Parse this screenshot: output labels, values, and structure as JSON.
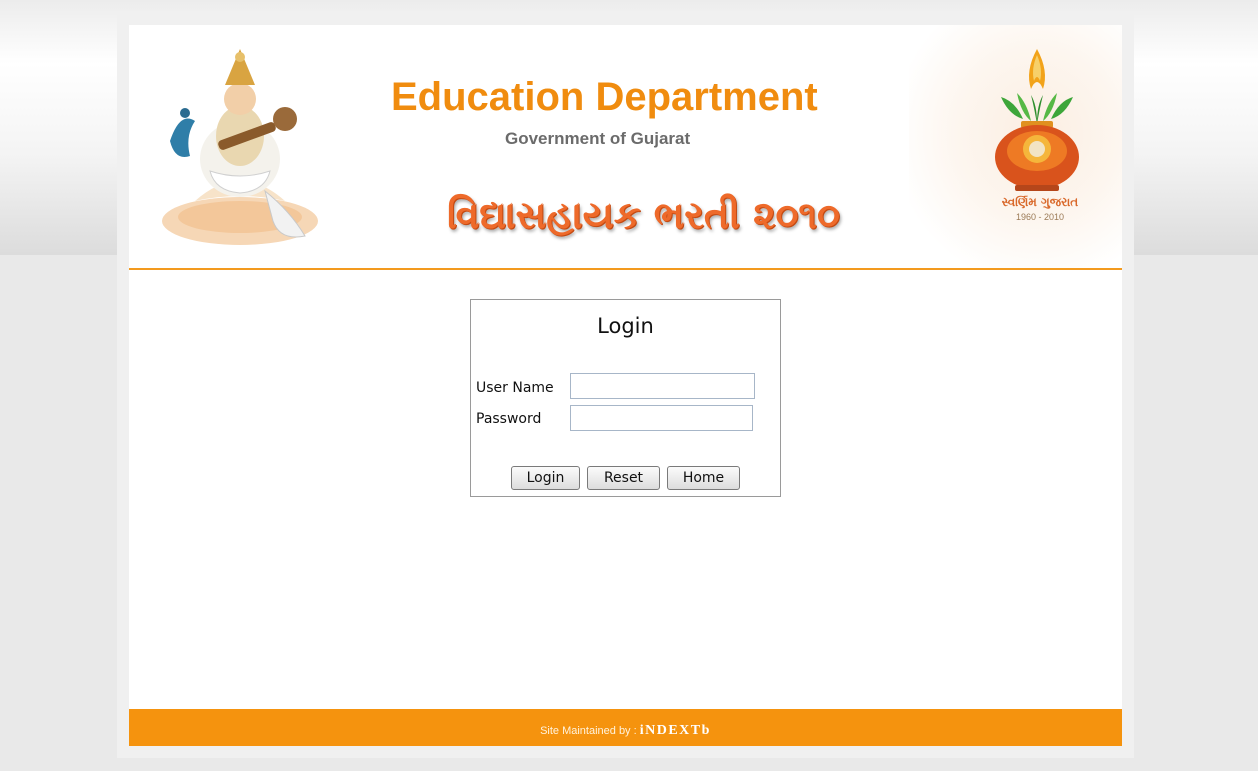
{
  "header": {
    "title": "Education Department",
    "subtitle": "Government of Gujarat",
    "recruitment_title": "વિદ્યાસહાયક ભરતી ૨૦૧૦",
    "swarnim_text": "સ્વર્ણિમ ગુજરાત",
    "swarnim_years": "1960 - 2010"
  },
  "login": {
    "title": "Login",
    "username_label": "User Name",
    "password_label": "Password",
    "username_value": "",
    "password_value": "",
    "buttons": {
      "login": "Login",
      "reset": "Reset",
      "home": "Home"
    }
  },
  "footer": {
    "label": "Site Maintained by : ",
    "brand": "iNDEXTb"
  },
  "colors": {
    "accent": "#f5930e",
    "title": "#f08c0f",
    "recruit": "#ee6a2a"
  }
}
